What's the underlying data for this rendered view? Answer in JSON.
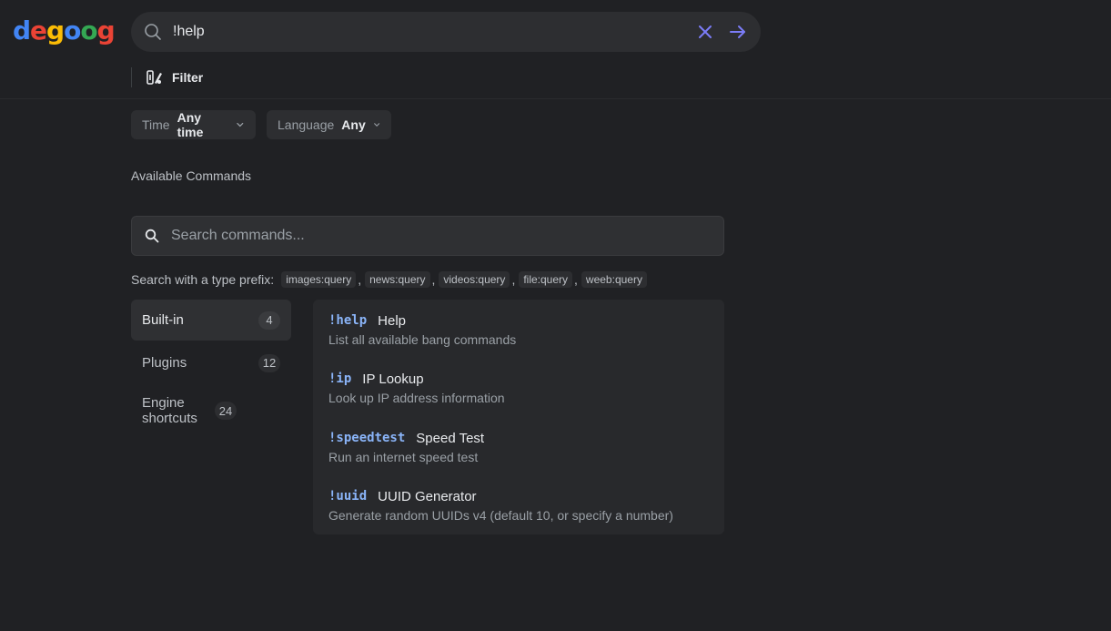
{
  "logo": {
    "letters": [
      "d",
      "e",
      "g",
      "o",
      "o",
      "g"
    ],
    "colors": [
      "#4285F4",
      "#EA4335",
      "#FBBC05",
      "#4285F4",
      "#34A853",
      "#EA4335"
    ]
  },
  "search": {
    "query": "!help",
    "icon": "search-icon"
  },
  "filter": {
    "label": "Filter",
    "icon": "filter-icon"
  },
  "dropdowns": {
    "time": {
      "label": "Time",
      "value": "Any time"
    },
    "language": {
      "label": "Language",
      "value": "Any"
    }
  },
  "commands_section": {
    "title": "Available Commands",
    "search_placeholder": "Search commands...",
    "prefix_hint": "Search with a type prefix:",
    "prefixes": [
      "images:query",
      "news:query",
      "videos:query",
      "file:query",
      "weeb:query"
    ]
  },
  "categories": [
    {
      "label": "Built-in",
      "count": "4",
      "active": true
    },
    {
      "label": "Plugins",
      "count": "12",
      "active": false
    },
    {
      "label": "Engine shortcuts",
      "count": "24",
      "active": false
    }
  ],
  "commands": [
    {
      "trigger": "!help",
      "name": "Help",
      "description": "List all available bang commands"
    },
    {
      "trigger": "!ip",
      "name": "IP Lookup",
      "description": "Look up IP address information"
    },
    {
      "trigger": "!speedtest",
      "name": "Speed Test",
      "description": "Run an internet speed test"
    },
    {
      "trigger": "!uuid",
      "name": "UUID Generator",
      "description": "Generate random UUIDs v4 (default 10, or specify a number)"
    }
  ],
  "colors": {
    "background": "#202124",
    "accent": "#8ab4f8",
    "action": "#7b7cf7"
  }
}
